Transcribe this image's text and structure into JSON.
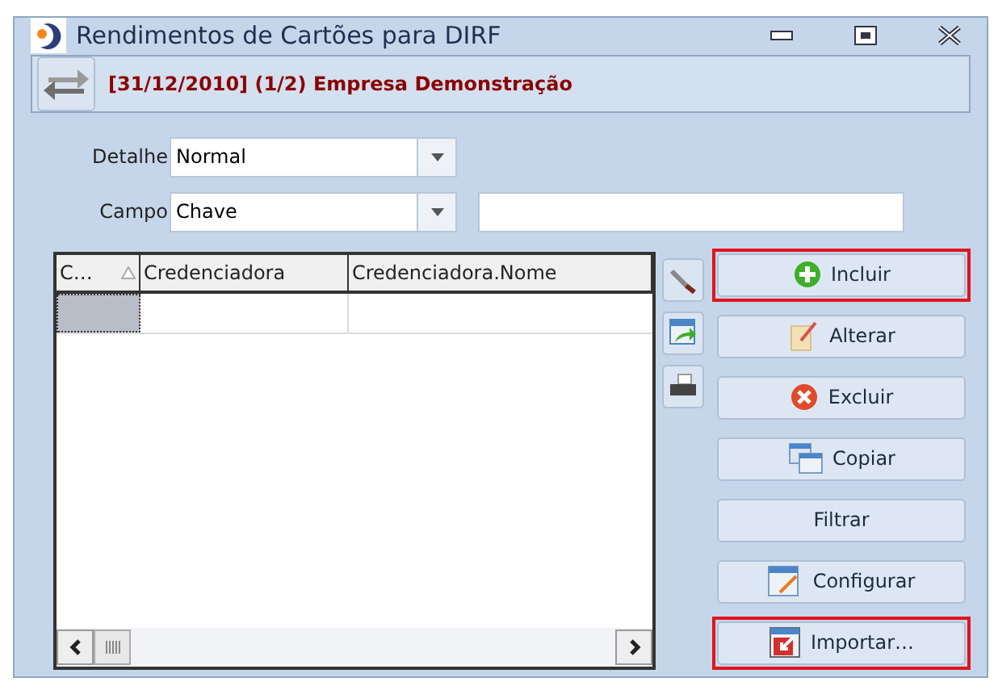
{
  "window": {
    "title": "Rendimentos de Cartões para DIRF"
  },
  "context": {
    "text": "[31/12/2010] (1/2) Empresa Demonstração"
  },
  "filters": [
    {
      "label": "Detalhe",
      "value": "Normal"
    },
    {
      "label": "Campo",
      "value": "Chave"
    }
  ],
  "grid": {
    "columns": [
      {
        "label": "C…",
        "sorted": true
      },
      {
        "label": "Credenciadora",
        "sorted": false
      },
      {
        "label": "Credenciadora.Nome",
        "sorted": false
      }
    ]
  },
  "buttons": [
    {
      "label": "Incluir",
      "highlighted": true
    },
    {
      "label": "Alterar",
      "highlighted": false
    },
    {
      "label": "Excluir",
      "highlighted": false
    },
    {
      "label": "Copiar",
      "highlighted": false
    },
    {
      "label": "Filtrar",
      "highlighted": false
    },
    {
      "label": "Configurar",
      "highlighted": false
    },
    {
      "label": "Importar…",
      "highlighted": true
    }
  ]
}
